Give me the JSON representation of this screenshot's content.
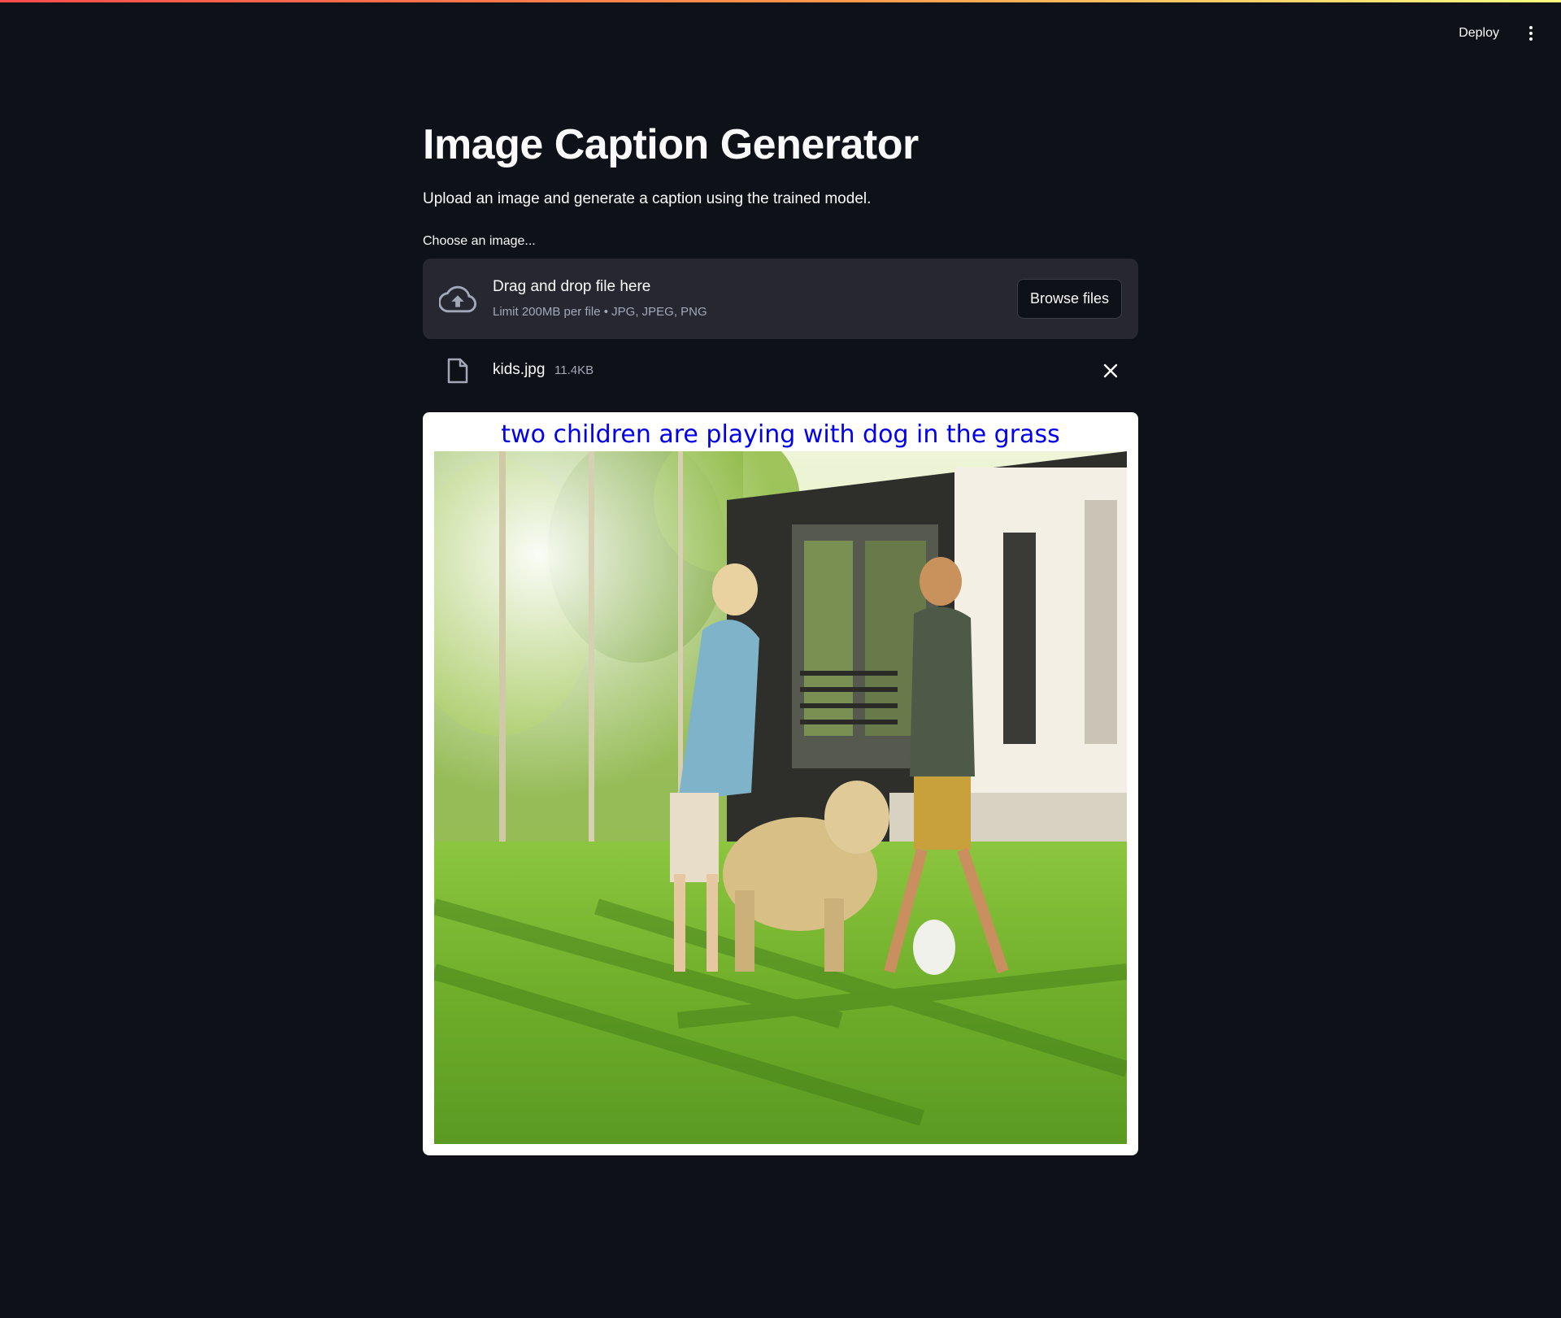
{
  "header": {
    "deploy_label": "Deploy",
    "menu_icon": "more-vertical-icon"
  },
  "page": {
    "title": "Image Caption Generator",
    "subtitle": "Upload an image and generate a caption using the trained model."
  },
  "uploader": {
    "label": "Choose an image...",
    "dropzone_title": "Drag and drop file here",
    "limit_text": "Limit 200MB per file • JPG, JPEG, PNG",
    "browse_label": "Browse files",
    "upload_icon": "cloud-upload-icon"
  },
  "uploaded_file": {
    "name": "kids.jpg",
    "size": "11.4KB",
    "file_icon": "file-icon",
    "remove_icon": "close-icon"
  },
  "result": {
    "caption": "two children are playing with dog in the grass",
    "caption_color": "#0000ee"
  },
  "colors": {
    "background": "#0e1117",
    "panel": "#262730",
    "text": "#fafafa",
    "muted": "#a3a8b8",
    "accent_gradient_start": "#ff4b4b",
    "accent_gradient_end": "#fffd80"
  }
}
